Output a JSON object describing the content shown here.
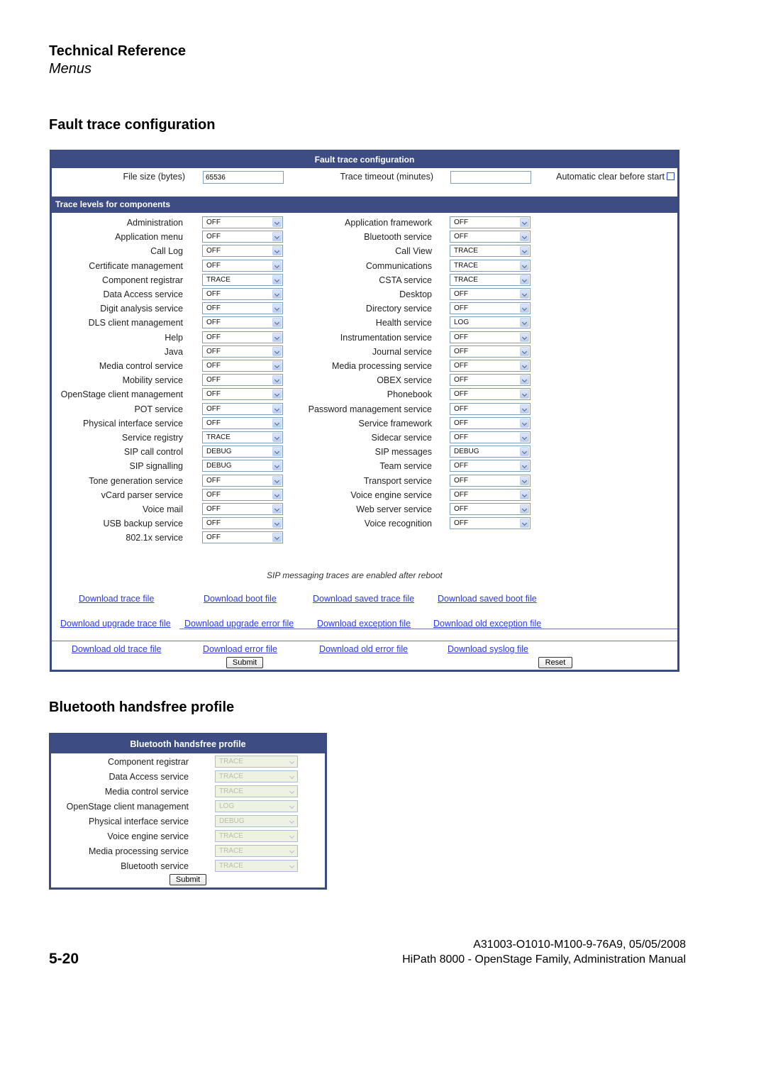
{
  "header": {
    "title": "Technical Reference",
    "subtitle": "Menus"
  },
  "sections": {
    "fault_trace_heading": "Fault trace configuration",
    "bluetooth_heading": "Bluetooth handsfree profile"
  },
  "fault_trace": {
    "panel_title": "Fault trace configuration",
    "file_size_label": "File size (bytes)",
    "file_size_value": "65536",
    "trace_timeout_label": "Trace timeout (minutes)",
    "trace_timeout_value": "",
    "auto_clear_label": "Automatic clear before start",
    "auto_clear_checked": false,
    "levels_title": "Trace levels for components",
    "left_components": [
      {
        "label": "Administration",
        "value": "OFF"
      },
      {
        "label": "Application menu",
        "value": "OFF"
      },
      {
        "label": "Call Log",
        "value": "OFF"
      },
      {
        "label": "Certificate management",
        "value": "OFF"
      },
      {
        "label": "Component registrar",
        "value": "TRACE"
      },
      {
        "label": "Data Access service",
        "value": "OFF"
      },
      {
        "label": "Digit analysis service",
        "value": "OFF"
      },
      {
        "label": "DLS client management",
        "value": "OFF"
      },
      {
        "label": "Help",
        "value": "OFF"
      },
      {
        "label": "Java",
        "value": "OFF"
      },
      {
        "label": "Media control service",
        "value": "OFF"
      },
      {
        "label": "Mobility service",
        "value": "OFF"
      },
      {
        "label": "OpenStage client management",
        "value": "OFF"
      },
      {
        "label": "POT service",
        "value": "OFF"
      },
      {
        "label": "Physical interface service",
        "value": "OFF"
      },
      {
        "label": "Service registry",
        "value": "TRACE"
      },
      {
        "label": "SIP call control",
        "value": "DEBUG"
      },
      {
        "label": "SIP signalling",
        "value": "DEBUG"
      },
      {
        "label": "Tone generation service",
        "value": "OFF"
      },
      {
        "label": "vCard parser service",
        "value": "OFF"
      },
      {
        "label": "Voice mail",
        "value": "OFF"
      },
      {
        "label": "USB backup service",
        "value": "OFF"
      },
      {
        "label": "802.1x service",
        "value": "OFF"
      }
    ],
    "right_components": [
      {
        "label": "Application framework",
        "value": "OFF"
      },
      {
        "label": "Bluetooth service",
        "value": "OFF"
      },
      {
        "label": "Call View",
        "value": "TRACE"
      },
      {
        "label": "Communications",
        "value": "TRACE"
      },
      {
        "label": "CSTA service",
        "value": "TRACE"
      },
      {
        "label": "Desktop",
        "value": "OFF"
      },
      {
        "label": "Directory service",
        "value": "OFF"
      },
      {
        "label": "Health service",
        "value": "LOG"
      },
      {
        "label": "Instrumentation service",
        "value": "OFF"
      },
      {
        "label": "Journal service",
        "value": "OFF"
      },
      {
        "label": "Media processing service",
        "value": "OFF"
      },
      {
        "label": "OBEX service",
        "value": "OFF"
      },
      {
        "label": "Phonebook",
        "value": "OFF"
      },
      {
        "label": "Password management service",
        "value": "OFF"
      },
      {
        "label": "Service framework",
        "value": "OFF"
      },
      {
        "label": "Sidecar service",
        "value": "OFF"
      },
      {
        "label": "SIP messages",
        "value": "DEBUG"
      },
      {
        "label": "Team service",
        "value": "OFF"
      },
      {
        "label": "Transport service",
        "value": "OFF"
      },
      {
        "label": "Voice engine service",
        "value": "OFF"
      },
      {
        "label": "Web server service",
        "value": "OFF"
      },
      {
        "label": "Voice recognition",
        "value": "OFF"
      }
    ],
    "note": "SIP messaging traces are enabled after reboot",
    "links_row1": [
      "Download trace file",
      "Download boot file",
      "Download saved trace file",
      "Download saved boot file"
    ],
    "links_row2": [
      "Download upgrade trace file",
      "Download upgrade error file",
      "Download exception file",
      "Download old exception file"
    ],
    "links_row3": [
      "Download old trace file",
      "Download error file",
      "Download old error file",
      "Download syslog file"
    ],
    "submit_label": "Submit",
    "reset_label": "Reset"
  },
  "bluetooth": {
    "panel_title": "Bluetooth handsfree profile",
    "components": [
      {
        "label": "Component registrar",
        "value": "TRACE"
      },
      {
        "label": "Data Access service",
        "value": "TRACE"
      },
      {
        "label": "Media control service",
        "value": "TRACE"
      },
      {
        "label": "OpenStage client management",
        "value": "LOG"
      },
      {
        "label": "Physical interface service",
        "value": "DEBUG"
      },
      {
        "label": "Voice engine service",
        "value": "TRACE"
      },
      {
        "label": "Media processing service",
        "value": "TRACE"
      },
      {
        "label": "Bluetooth service",
        "value": "TRACE"
      }
    ],
    "submit_label": "Submit"
  },
  "footer": {
    "page_number": "5-20",
    "doc_id": "A31003-O1010-M100-9-76A9, 05/05/2008",
    "manual_title": "HiPath 8000 - OpenStage Family, Administration Manual"
  },
  "colors": {
    "panel_bar": "#3d4c82",
    "link": "#2d3be0",
    "disabled_select_bg": "#eef2e2"
  }
}
